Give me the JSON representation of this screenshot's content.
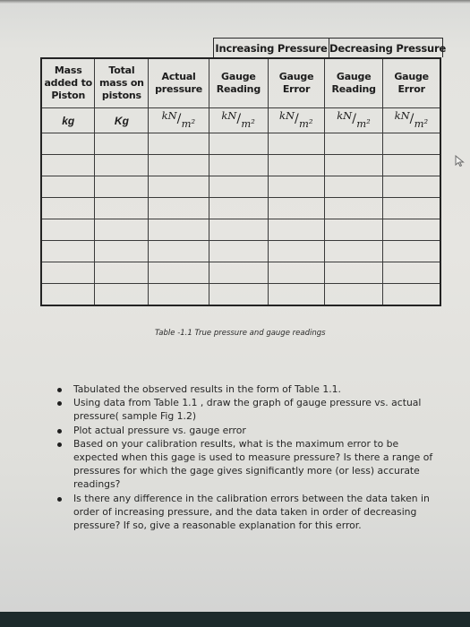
{
  "table": {
    "group_headers": [
      "Increasing Pressure",
      "Decreasing Pressure"
    ],
    "columns": [
      {
        "header": [
          "Mass",
          "added to",
          "Piston"
        ],
        "unit": "kg"
      },
      {
        "header": [
          "Total",
          "mass on",
          "pistons"
        ],
        "unit": "Kg"
      },
      {
        "header": [
          "Actual",
          "pressure"
        ],
        "unit_num": "kN",
        "unit_den": "m²"
      },
      {
        "header": [
          "Gauge",
          "Reading"
        ],
        "unit_num": "kN",
        "unit_den": "m²"
      },
      {
        "header": [
          "Gauge",
          "Error"
        ],
        "unit_num": "kN",
        "unit_den": "m²"
      },
      {
        "header": [
          "Gauge",
          "Reading"
        ],
        "unit_num": "kN",
        "unit_den": "m²"
      },
      {
        "header": [
          "Gauge",
          "Error"
        ],
        "unit_num": "kN",
        "unit_den": "m²"
      }
    ],
    "empty_row_count": 8,
    "caption": "Table -1.1 True pressure and gauge readings"
  },
  "questions": [
    "Tabulated the observed results in the form of Table 1.1.",
    "Using data from Table 1.1 , draw the graph of gauge pressure vs. actual pressure( sample Fig 1.2)",
    "Plot actual pressure vs. gauge error",
    "Based on your calibration results, what is the maximum error to be expected when this gage is used to measure pressure? Is there a range of pressures for which the gage gives significantly more (or less) accurate readings?",
    "Is there any difference in the calibration errors between the data taken in order of increasing pressure, and the data taken in order of decreasing pressure? If so, give a reasonable explanation for this error."
  ],
  "cursor_icon": "mouse-pointer"
}
